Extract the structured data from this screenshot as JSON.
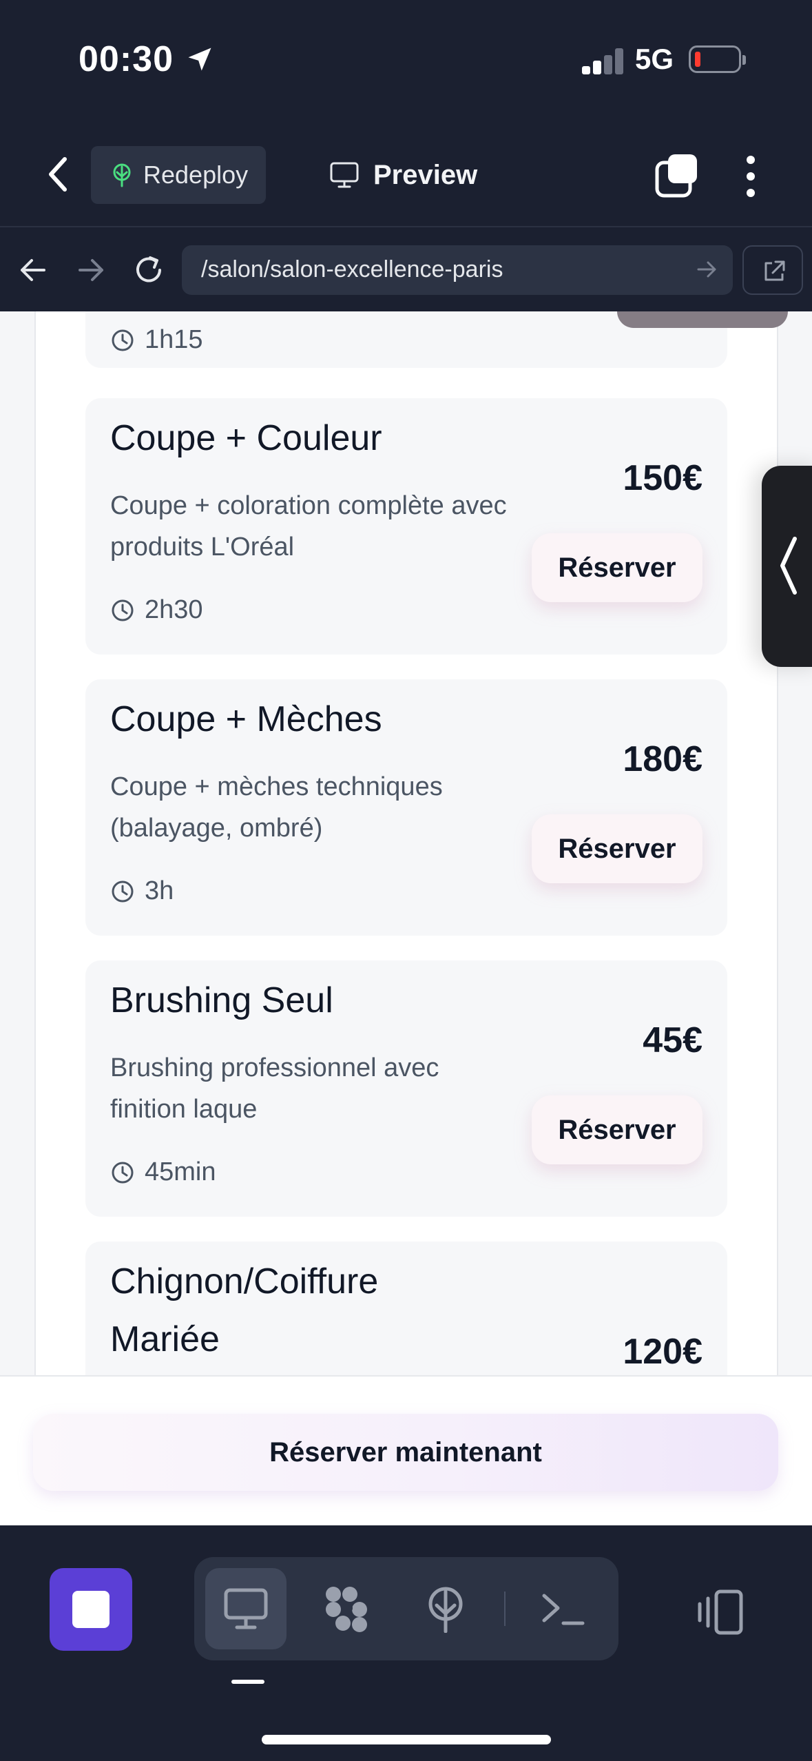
{
  "status_bar": {
    "time": "00:30",
    "network": "5G"
  },
  "toolbar": {
    "redeploy_label": "Redeploy",
    "preview_label": "Preview"
  },
  "url_bar": {
    "url": "/salon/salon-excellence-paris"
  },
  "services": [
    {
      "duration": "1h15"
    },
    {
      "title": "Coupe + Couleur",
      "description": "Coupe + coloration complète avec produits L'Oréal",
      "duration": "2h30",
      "price": "150€",
      "button": "Réserver"
    },
    {
      "title": "Coupe + Mèches",
      "description": "Coupe + mèches techniques (balayage, ombré)",
      "duration": "3h",
      "price": "180€",
      "button": "Réserver"
    },
    {
      "title": "Brushing Seul",
      "description": "Brushing professionnel avec finition laque",
      "duration": "45min",
      "price": "45€",
      "button": "Réserver"
    },
    {
      "title": "Chignon/Coiffure Mariée",
      "price": "120€"
    }
  ],
  "booking": {
    "cta": "Réserver maintenant"
  },
  "colors": {
    "accent": "#5b3fd6",
    "dark_bg": "#1b2030",
    "battery_low": "#ff3b30"
  }
}
